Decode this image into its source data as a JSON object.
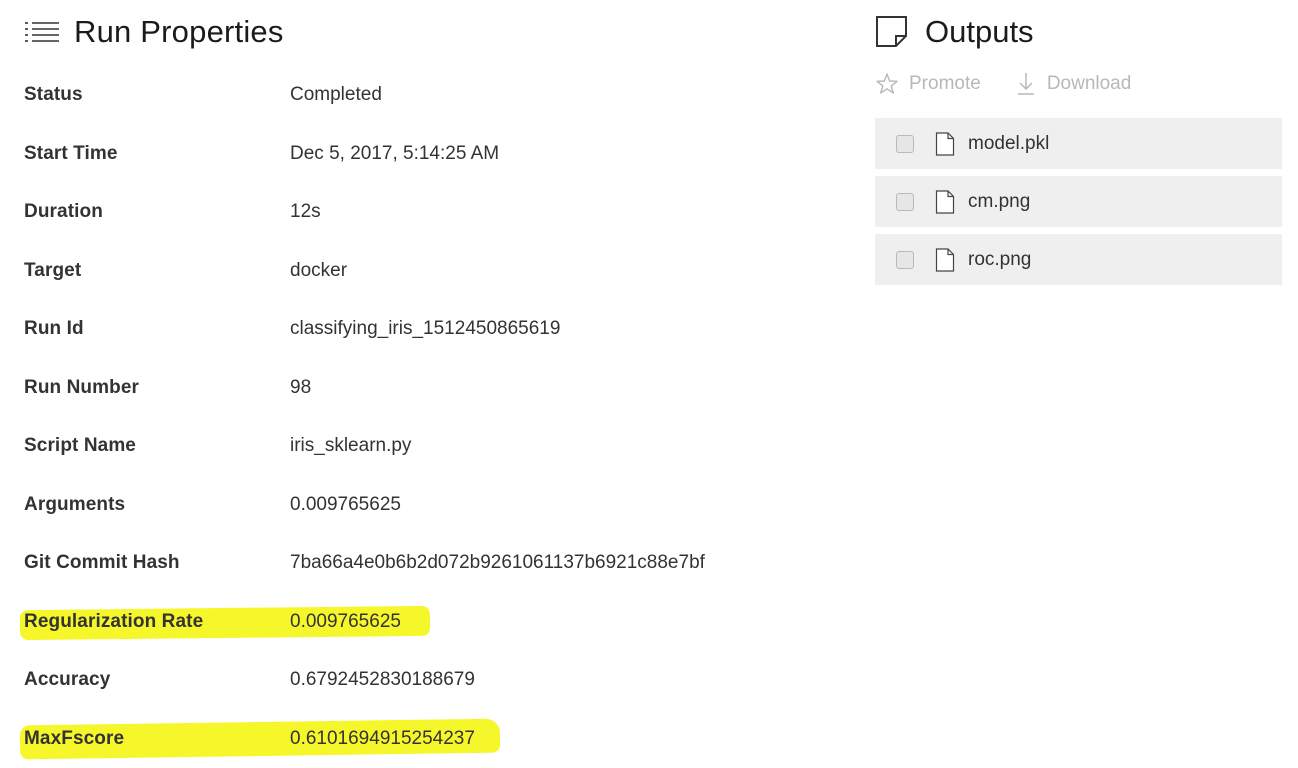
{
  "run_properties": {
    "title": "Run Properties",
    "rows": [
      {
        "label": "Status",
        "value": "Completed"
      },
      {
        "label": "Start Time",
        "value": "Dec 5, 2017, 5:14:25 AM"
      },
      {
        "label": "Duration",
        "value": "12s"
      },
      {
        "label": "Target",
        "value": "docker"
      },
      {
        "label": "Run Id",
        "value": "classifying_iris_1512450865619"
      },
      {
        "label": "Run Number",
        "value": "98"
      },
      {
        "label": "Script Name",
        "value": "iris_sklearn.py"
      },
      {
        "label": "Arguments",
        "value": "0.009765625"
      },
      {
        "label": "Git Commit Hash",
        "value": "7ba66a4e0b6b2d072b9261061137b6921c88e7bf"
      },
      {
        "label": "Regularization Rate",
        "value": "0.009765625"
      },
      {
        "label": "Accuracy",
        "value": "0.6792452830188679"
      },
      {
        "label": "MaxFscore",
        "value": "0.6101694915254237"
      }
    ]
  },
  "outputs": {
    "title": "Outputs",
    "promote_label": "Promote",
    "download_label": "Download",
    "files": [
      {
        "name": "model.pkl"
      },
      {
        "name": "cm.png"
      },
      {
        "name": "roc.png"
      }
    ]
  },
  "colors": {
    "highlight": "#f6f72a",
    "disabled_text": "#b8b8b8",
    "file_row_bg": "#efefef"
  }
}
